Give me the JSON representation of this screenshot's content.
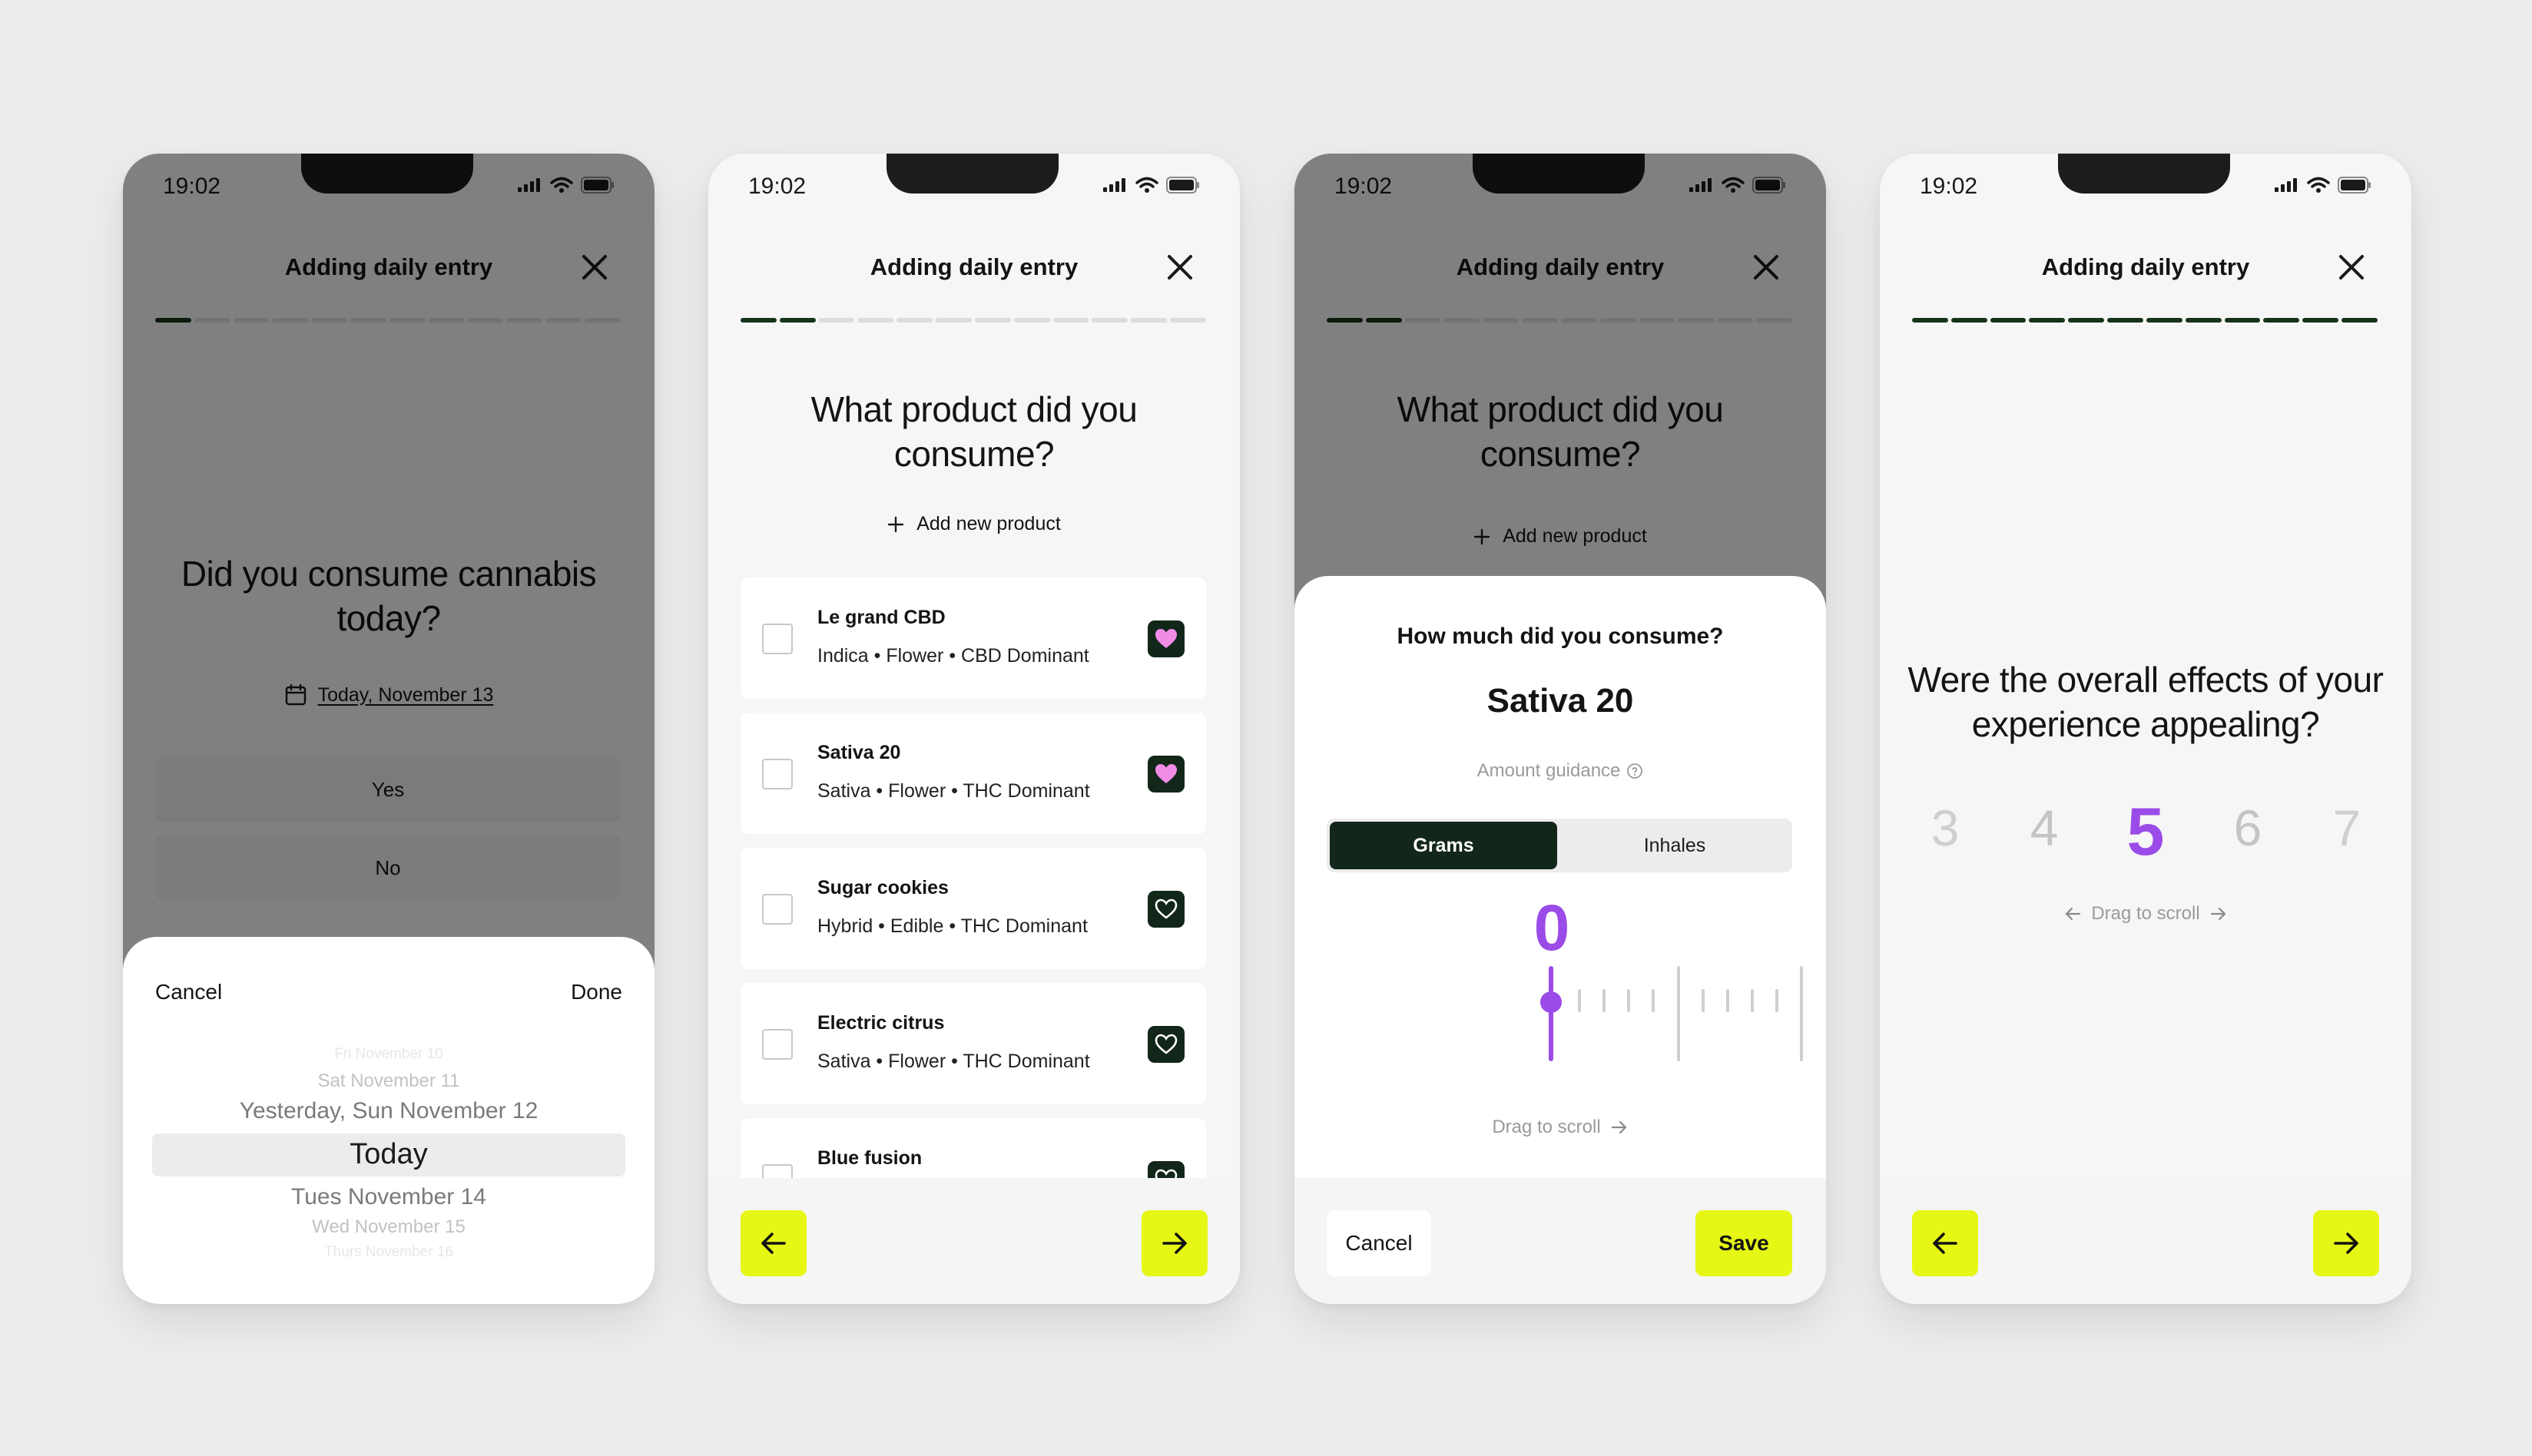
{
  "status": {
    "time": "19:02"
  },
  "header": {
    "title": "Adding daily entry"
  },
  "screen1": {
    "question": "Did you consume cannabis today?",
    "date_label": "Today, November 13",
    "options": [
      "Yes",
      "No"
    ],
    "picker": {
      "cancel": "Cancel",
      "done": "Done",
      "items": [
        "Fri November 10",
        "Sat November 11",
        "Yesterday, Sun November 12",
        "Today",
        "Tues November 14",
        "Wed November 15",
        "Thurs November 16"
      ],
      "selected": "Today"
    },
    "progress": {
      "total": 12,
      "done": 1
    }
  },
  "screen2": {
    "question": "What product did you consume?",
    "add_label": "Add new product",
    "products": [
      {
        "name": "Le grand CBD",
        "meta": "Indica • Flower • CBD Dominant",
        "favorite": true
      },
      {
        "name": "Sativa 20",
        "meta": "Sativa • Flower • THC Dominant",
        "favorite": true
      },
      {
        "name": "Sugar cookies",
        "meta": "Hybrid • Edible • THC Dominant",
        "favorite": false
      },
      {
        "name": "Electric citrus",
        "meta": "Sativa • Flower • THC Dominant",
        "favorite": false
      },
      {
        "name": "Blue fusion",
        "meta": "",
        "favorite": false
      }
    ],
    "progress": {
      "total": 12,
      "done": 2
    }
  },
  "screen3": {
    "question": "What product did you consume?",
    "add_label": "Add new product",
    "sheet": {
      "title": "How much did you consume?",
      "product": "Sativa 20",
      "guidance": "Amount guidance",
      "tabs": [
        "Grams",
        "Inhales"
      ],
      "active_tab": "Grams",
      "value": "0",
      "drag_hint": "Drag to scroll",
      "cancel": "Cancel",
      "save": "Save"
    },
    "progress": {
      "total": 12,
      "done": 2
    }
  },
  "screen4": {
    "question": "Were the overall effects of your experience appealing?",
    "scale": [
      "3",
      "4",
      "5",
      "6",
      "7"
    ],
    "selected": "5",
    "drag_hint": "Drag to scroll",
    "progress": {
      "total": 12,
      "done": 12
    }
  },
  "colors": {
    "accent": "#e6f716",
    "dark_green": "#12261a",
    "purple": "#9b4be8",
    "favorite_pink": "#f08ce6"
  },
  "icons": [
    "signal-icon",
    "wifi-icon",
    "battery-icon",
    "close-icon",
    "calendar-icon",
    "plus-icon",
    "heart-icon",
    "help-circle-icon",
    "arrow-left-icon",
    "arrow-right-icon"
  ]
}
